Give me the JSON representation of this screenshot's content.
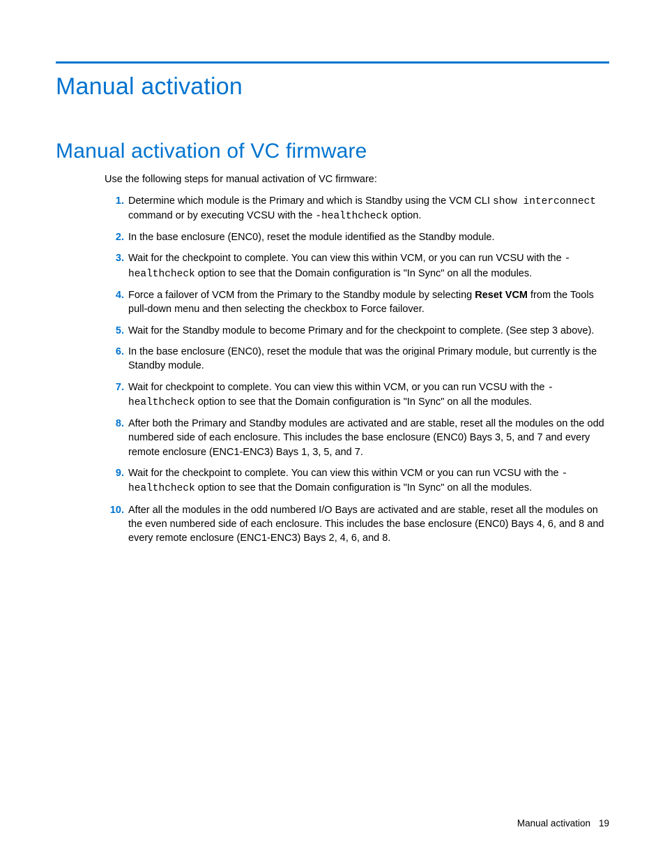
{
  "rule_color": "#0073cf",
  "heading1": "Manual activation",
  "heading2": "Manual activation of VC firmware",
  "intro": "Use the following steps for manual activation of VC firmware:",
  "steps": [
    {
      "pre": "Determine which module is the Primary and which is Standby using the VCM CLI ",
      "code1": "show interconnect",
      "mid1": " command or by executing VCSU with the ",
      "code2": "-healthcheck",
      "post": " option."
    },
    {
      "text": "In the base enclosure (ENC0), reset the module identified as the Standby module."
    },
    {
      "pre": "Wait for the checkpoint to complete. You can view this within VCM, or you can run VCSU with the ",
      "code1": "-healthcheck",
      "post": " option to see that the Domain configuration is \"In Sync\" on all the modules."
    },
    {
      "pre": "Force a failover of VCM from the Primary to the Standby module by selecting ",
      "bold": "Reset VCM",
      "post": " from the Tools pull-down menu and then selecting the checkbox to Force failover."
    },
    {
      "text": "Wait for the Standby module to become Primary and for the checkpoint to complete. (See step 3 above)."
    },
    {
      "text": "In the base enclosure (ENC0), reset the module that was the original Primary module, but currently is the Standby module."
    },
    {
      "pre": "Wait for checkpoint to complete. You can view this within VCM, or you can run VCSU with the ",
      "code1": "-healthcheck",
      "post": " option to see that the Domain configuration is \"In Sync\" on all the modules."
    },
    {
      "text": "After both the Primary and Standby modules are activated and are stable, reset all the modules on the odd numbered side of each enclosure. This includes the base enclosure (ENC0) Bays 3, 5, and 7 and every remote enclosure (ENC1-ENC3) Bays 1, 3, 5, and 7."
    },
    {
      "pre": "Wait for the checkpoint to complete. You can view this within VCM or you can run VCSU with the ",
      "code1": "-healthcheck",
      "post": " option to see that the Domain configuration is \"In Sync\" on all the modules."
    },
    {
      "text": "After all the modules in the odd numbered I/O Bays are activated and are stable, reset all the modules on the even numbered side of each enclosure. This includes the base enclosure (ENC0) Bays 4, 6, and 8 and every remote enclosure (ENC1-ENC3) Bays 2, 4, 6, and 8."
    }
  ],
  "footer_section": "Manual activation",
  "footer_page": "19"
}
